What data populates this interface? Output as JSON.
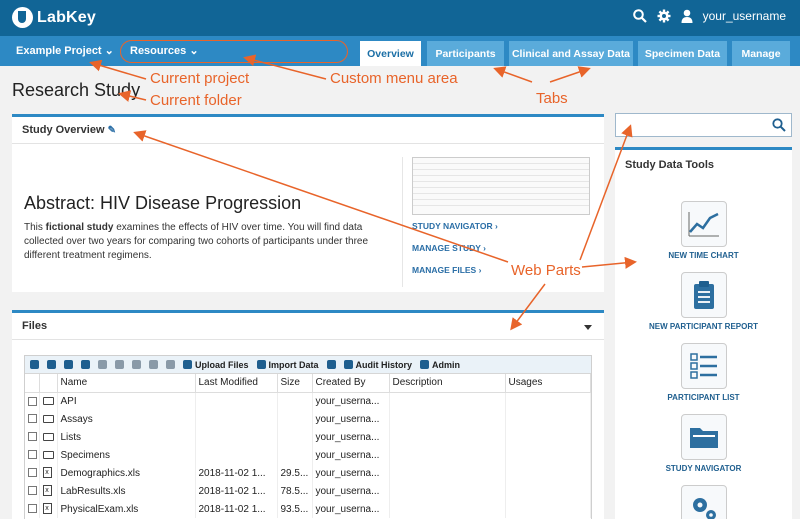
{
  "header": {
    "logo_text": "LabKey",
    "username": "your_username"
  },
  "nav": {
    "project_label": "Example Project",
    "resources_label": "Resources",
    "tabs": [
      {
        "label": "Overview",
        "active": true
      },
      {
        "label": "Participants"
      },
      {
        "label": "Clinical and Assay Data"
      },
      {
        "label": "Specimen Data"
      },
      {
        "label": "Manage"
      }
    ]
  },
  "annotations": {
    "current_project": "Current project",
    "custom_menu": "Custom menu area",
    "current_folder": "Current folder",
    "tabs": "Tabs",
    "web_parts": "Web Parts"
  },
  "page_title": "Research Study",
  "overview": {
    "title": "Study Overview",
    "abstract_title": "Abstract: HIV Disease Progression",
    "abstract_pre": "This ",
    "abstract_bold": "fictional study",
    "abstract_post": " examines the effects of HIV over time. You will find data collected over two years for comparing two cohorts of participants under three different treatment regimens.",
    "links": [
      "STUDY NAVIGATOR ›",
      "MANAGE STUDY ›",
      "MANAGE FILES ›"
    ]
  },
  "files": {
    "title": "Files",
    "toolbar": {
      "upload": "Upload Files",
      "import": "Import Data",
      "audit": "Audit History",
      "admin": "Admin"
    },
    "columns": [
      "Name",
      "Last Modified",
      "Size",
      "Created By",
      "Description",
      "Usages"
    ],
    "rows": [
      {
        "type": "folder",
        "name": "API",
        "modified": "",
        "size": "",
        "created_by": "your_userna..."
      },
      {
        "type": "folder",
        "name": "Assays",
        "modified": "",
        "size": "",
        "created_by": "your_userna..."
      },
      {
        "type": "folder",
        "name": "Lists",
        "modified": "",
        "size": "",
        "created_by": "your_userna..."
      },
      {
        "type": "folder",
        "name": "Specimens",
        "modified": "",
        "size": "",
        "created_by": "your_userna..."
      },
      {
        "type": "xls",
        "name": "Demographics.xls",
        "modified": "2018-11-02 1...",
        "size": "29.5...",
        "created_by": "your_userna..."
      },
      {
        "type": "xls",
        "name": "LabResults.xls",
        "modified": "2018-11-02 1...",
        "size": "78.5...",
        "created_by": "your_userna..."
      },
      {
        "type": "xls",
        "name": "PhysicalExam.xls",
        "modified": "2018-11-02 1...",
        "size": "93.5...",
        "created_by": "your_userna..."
      }
    ]
  },
  "tools": {
    "title": "Study Data Tools",
    "items": [
      "NEW TIME CHART",
      "NEW PARTICIPANT REPORT",
      "PARTICIPANT LIST",
      "STUDY NAVIGATOR"
    ]
  },
  "colors": {
    "header": "#116596",
    "nav": "#2d89c4",
    "tab": "#5aabdb",
    "annotation": "#e8642a"
  }
}
